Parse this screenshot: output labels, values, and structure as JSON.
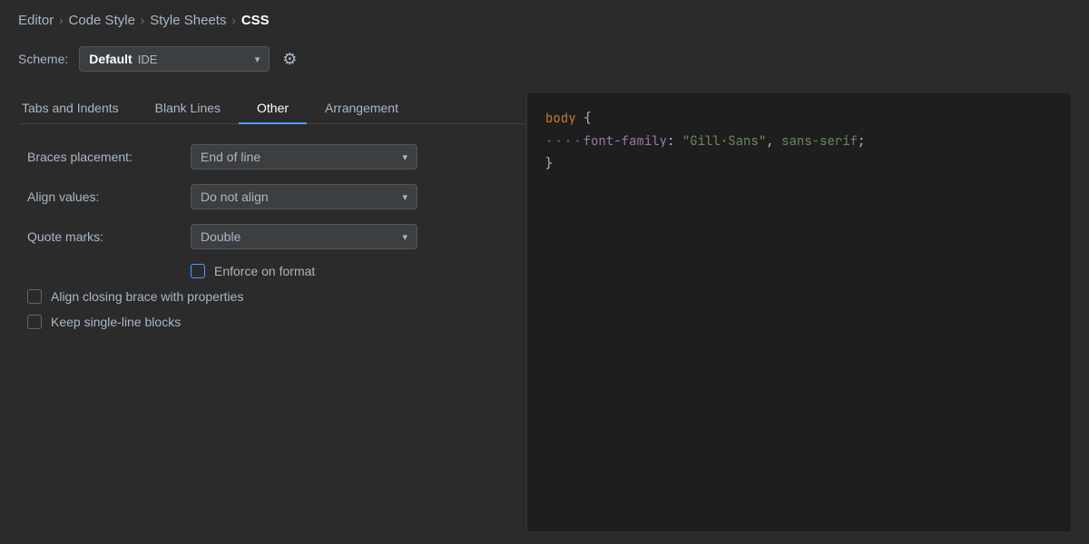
{
  "breadcrumb": {
    "items": [
      {
        "label": "Editor",
        "active": false
      },
      {
        "label": "Code Style",
        "active": false
      },
      {
        "label": "Style Sheets",
        "active": false
      },
      {
        "label": "CSS",
        "active": true
      }
    ],
    "separator": "›"
  },
  "scheme": {
    "label": "Scheme:",
    "bold_text": "Default",
    "sub_text": "IDE",
    "placeholder": "Default IDE"
  },
  "tabs": [
    {
      "label": "Tabs and Indents",
      "active": false
    },
    {
      "label": "Blank Lines",
      "active": false
    },
    {
      "label": "Other",
      "active": true
    },
    {
      "label": "Arrangement",
      "active": false
    }
  ],
  "settings": {
    "braces_placement": {
      "label": "Braces placement:",
      "value": "End of line"
    },
    "align_values": {
      "label": "Align values:",
      "value": "Do not align"
    },
    "quote_marks": {
      "label": "Quote marks:",
      "value": "Double"
    }
  },
  "checkboxes": [
    {
      "id": "enforce-on-format",
      "label": "Enforce on format",
      "checked": false,
      "partial": true,
      "indented": true
    },
    {
      "id": "align-closing-brace",
      "label": "Align closing brace with properties",
      "checked": false,
      "partial": false,
      "indented": false
    },
    {
      "id": "keep-single-line",
      "label": "Keep single-line blocks",
      "checked": false,
      "partial": false,
      "indented": false
    }
  ],
  "code_preview": {
    "lines": [
      {
        "type": "keyword-brace",
        "keyword": "body",
        "brace": " {"
      },
      {
        "type": "property-line",
        "dots": "····",
        "property": "font-family",
        "colon": ":",
        "values": [
          {
            "text": " \"Gill·Sans\"",
            "type": "string"
          },
          {
            "text": ",",
            "type": "comma"
          },
          {
            "text": " sans-serif",
            "type": "string"
          },
          {
            "text": ";",
            "type": "punctuation"
          }
        ]
      },
      {
        "type": "closing-brace",
        "brace": "}"
      }
    ]
  },
  "icons": {
    "gear": "⚙",
    "dropdown_arrow": "▾",
    "cursor": "|"
  }
}
